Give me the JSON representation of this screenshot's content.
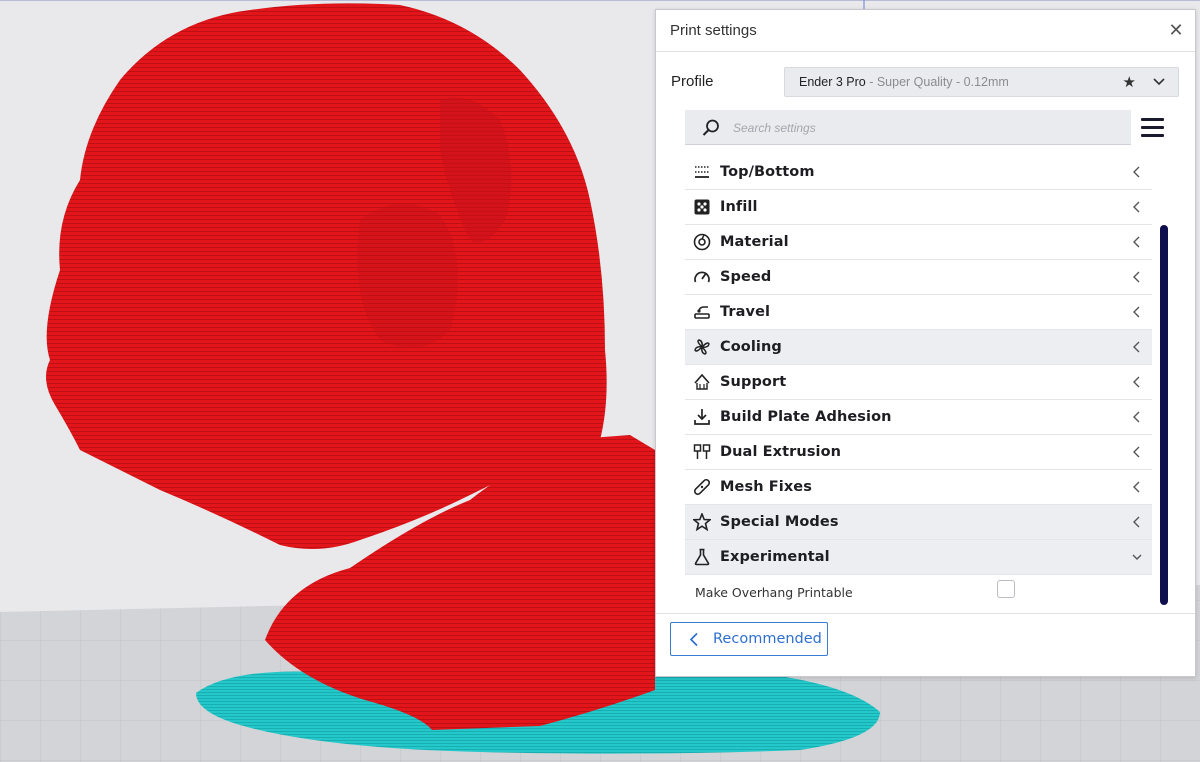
{
  "panel": {
    "title": "Print settings",
    "close_icon": "close-icon",
    "profile": {
      "label": "Profile",
      "machine": "Ender 3 Pro",
      "quality": " - Super Quality - 0.12mm",
      "favorite_icon": "star-icon",
      "expand_icon": "chevron-down-icon"
    },
    "search": {
      "placeholder": "Search settings",
      "value": ""
    },
    "menu_icon": "hamburger-menu-icon",
    "categories": [
      {
        "label": "Top/Bottom",
        "icon": "top-bottom-icon",
        "state": "collapsed"
      },
      {
        "label": "Infill",
        "icon": "infill-icon",
        "state": "collapsed"
      },
      {
        "label": "Material",
        "icon": "material-icon",
        "state": "collapsed"
      },
      {
        "label": "Speed",
        "icon": "speed-icon",
        "state": "collapsed"
      },
      {
        "label": "Travel",
        "icon": "travel-icon",
        "state": "collapsed"
      },
      {
        "label": "Cooling",
        "icon": "cooling-fan-icon",
        "state": "collapsed"
      },
      {
        "label": "Support",
        "icon": "support-icon",
        "state": "collapsed"
      },
      {
        "label": "Build Plate Adhesion",
        "icon": "build-plate-adhesion-icon",
        "state": "collapsed"
      },
      {
        "label": "Dual Extrusion",
        "icon": "dual-extrusion-icon",
        "state": "collapsed"
      },
      {
        "label": "Mesh Fixes",
        "icon": "mesh-fixes-icon",
        "state": "collapsed"
      },
      {
        "label": "Special Modes",
        "icon": "special-modes-icon",
        "state": "collapsed"
      },
      {
        "label": "Experimental",
        "icon": "experimental-flask-icon",
        "state": "expanded"
      }
    ],
    "experimental_settings": [
      {
        "label": "Make Overhang Printable",
        "checked": false
      }
    ],
    "footer": {
      "recommended_label": "Recommended",
      "recommended_icon": "chevron-left-icon"
    }
  },
  "colors": {
    "model_red": "#e0141a",
    "adhesion_cyan": "#22c6c8",
    "scrollbar": "#0f0f4d",
    "accent_blue": "#2f6fd0",
    "viewport_bg": "#e8e8ea"
  }
}
